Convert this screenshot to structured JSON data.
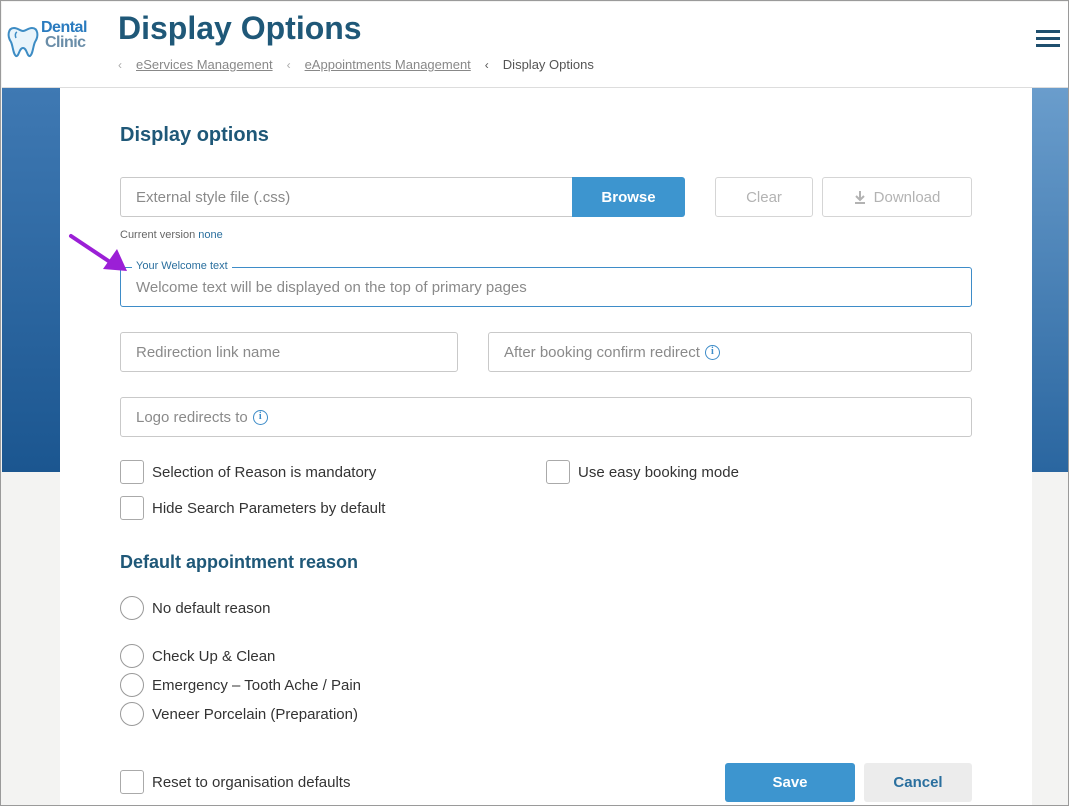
{
  "header": {
    "logo_line1": "Dental",
    "logo_line2": "Clinic",
    "title": "Display Options",
    "breadcrumb": [
      "eServices Management",
      "eAppointments Management",
      "Display Options"
    ]
  },
  "display_options": {
    "heading": "Display options",
    "style_file_placeholder": "External style file (.css)",
    "browse_label": "Browse",
    "clear_label": "Clear",
    "download_label": "Download",
    "current_version_label": "Current version",
    "current_version_value": "none",
    "welcome_label": "Your Welcome text",
    "welcome_placeholder": "Welcome text will be displayed on the top of primary pages",
    "redirection_link_placeholder": "Redirection link name",
    "after_booking_placeholder": "After booking confirm redirect",
    "logo_redirect_placeholder": "Logo redirects to",
    "checkboxes": {
      "reason_mandatory": "Selection of Reason is mandatory",
      "easy_booking": "Use easy booking mode",
      "hide_search": "Hide Search Parameters by default"
    }
  },
  "default_reason": {
    "heading": "Default appointment reason",
    "options": [
      "No default reason",
      "Check Up & Clean",
      "Emergency – Tooth Ache / Pain",
      "Veneer Porcelain (Preparation)"
    ]
  },
  "footer": {
    "reset_label": "Reset to organisation defaults",
    "save_label": "Save",
    "cancel_label": "Cancel"
  },
  "colors": {
    "brand": "#1f5878",
    "accent": "#3d95cf",
    "annotation_arrow": "#9b1fd6"
  }
}
